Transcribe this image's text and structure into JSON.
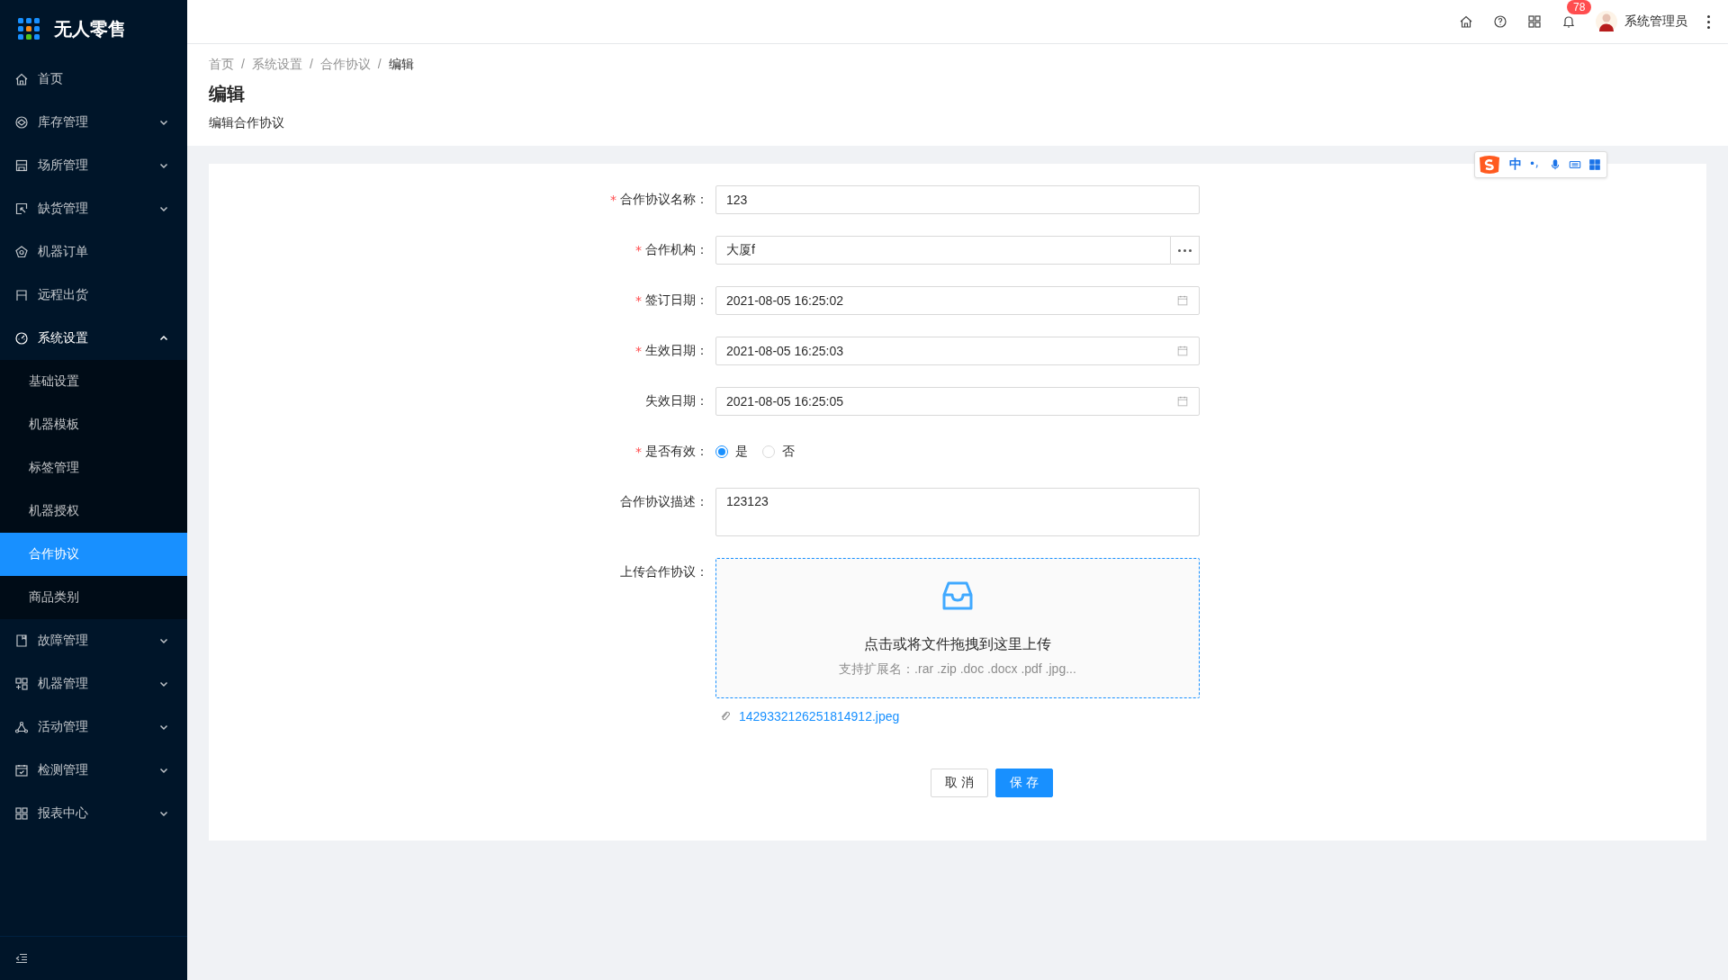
{
  "app": {
    "title": "无人零售"
  },
  "sidebar": {
    "items": [
      {
        "label": "首页",
        "selected": false
      },
      {
        "label": "库存管理",
        "expanded": false,
        "selected": false
      },
      {
        "label": "场所管理",
        "expanded": false,
        "selected": false
      },
      {
        "label": "缺货管理",
        "expanded": false,
        "selected": false
      },
      {
        "label": "机器订单",
        "selected": false
      },
      {
        "label": "远程出货",
        "selected": false
      },
      {
        "label": "系统设置",
        "expanded": true,
        "selected": false,
        "children": [
          {
            "label": "基础设置",
            "selected": false
          },
          {
            "label": "机器模板",
            "selected": false
          },
          {
            "label": "标签管理",
            "selected": false
          },
          {
            "label": "机器授权",
            "selected": false
          },
          {
            "label": "合作协议",
            "selected": true
          },
          {
            "label": "商品类别",
            "selected": false
          }
        ]
      },
      {
        "label": "故障管理",
        "expanded": false,
        "selected": false
      },
      {
        "label": "机器管理",
        "expanded": false,
        "selected": false
      },
      {
        "label": "活动管理",
        "expanded": false,
        "selected": false
      },
      {
        "label": "检测管理",
        "expanded": false,
        "selected": false
      },
      {
        "label": "报表中心",
        "expanded": false,
        "selected": false
      }
    ]
  },
  "header": {
    "notification_count": "78",
    "user": "系统管理员"
  },
  "breadcrumb": {
    "separator": "/",
    "items": [
      "首页",
      "系统设置",
      "合作协议",
      "编辑"
    ]
  },
  "page": {
    "title": "编辑",
    "subtitle": "编辑合作协议"
  },
  "ime_toolbar": {
    "mode": "中"
  },
  "form": {
    "required_mark": "*",
    "fields": [
      {
        "kind": "text",
        "label": "合作协议名称：",
        "required": true,
        "value": "123"
      },
      {
        "kind": "picker",
        "label": "合作机构：",
        "required": true,
        "value": "大厦f"
      },
      {
        "kind": "date",
        "label": "签订日期：",
        "required": true,
        "value": "2021-08-05 16:25:02"
      },
      {
        "kind": "date",
        "label": "生效日期：",
        "required": true,
        "value": "2021-08-05 16:25:03"
      },
      {
        "kind": "date",
        "label": "失效日期：",
        "required": false,
        "value": "2021-08-05 16:25:05"
      },
      {
        "kind": "radio",
        "label": "是否有效：",
        "required": true,
        "options": [
          {
            "label": "是",
            "selected": true
          },
          {
            "label": "否",
            "selected": false
          }
        ]
      },
      {
        "kind": "textarea",
        "label": "合作协议描述：",
        "required": false,
        "value": "123123"
      },
      {
        "kind": "upload",
        "label": "上传合作协议：",
        "required": false,
        "hint": "点击或将文件拖拽到这里上传",
        "extensions": "支持扩展名：.rar .zip .doc .docx .pdf .jpg...",
        "files": [
          "1429332126251814912.jpeg"
        ]
      }
    ],
    "buttons": [
      {
        "label": "取 消",
        "kind": "default"
      },
      {
        "label": "保 存",
        "kind": "primary"
      }
    ]
  }
}
